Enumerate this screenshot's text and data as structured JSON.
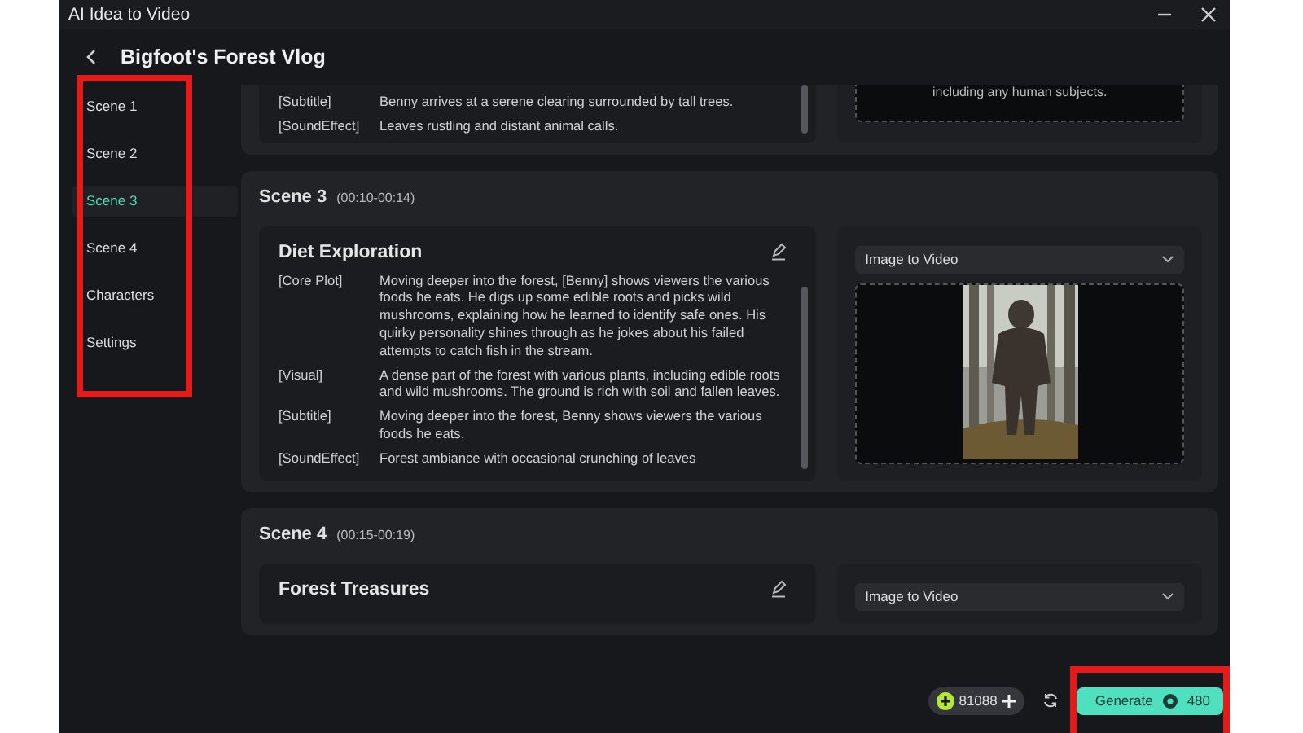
{
  "window": {
    "title": "AI Idea to Video"
  },
  "header": {
    "title": "Bigfoot's Forest Vlog"
  },
  "sidebar": {
    "items": [
      {
        "label": "Scene 1",
        "selected": false
      },
      {
        "label": "Scene 2",
        "selected": false
      },
      {
        "label": "Scene 3",
        "selected": true
      },
      {
        "label": "Scene 4",
        "selected": false
      },
      {
        "label": "Characters",
        "selected": false
      },
      {
        "label": "Settings",
        "selected": false
      }
    ]
  },
  "previous_scene": {
    "rows": [
      {
        "label": "[Subtitle]",
        "text": "Benny arrives at a serene clearing surrounded by tall trees."
      },
      {
        "label": "[SoundEffect]",
        "text": "Leaves rustling and distant animal calls."
      }
    ],
    "preview_text": "including any human subjects."
  },
  "scenes": [
    {
      "title": "Scene 3",
      "time": "(00:10-00:14)",
      "card": {
        "title": "Diet Exploration",
        "rows": [
          {
            "label": "[Core Plot]",
            "text": "Moving deeper into the forest, [Benny] shows viewers the various foods he eats. He digs up some edible roots and picks wild mushrooms, explaining how he learned to identify safe ones. His quirky personality shines through as he jokes about his failed attempts to catch fish in the stream."
          },
          {
            "label": "[Visual]",
            "text": "A dense part of the forest with various plants, including edible roots and wild mushrooms. The ground is rich with soil and fallen leaves."
          },
          {
            "label": "[Subtitle]",
            "text": "Moving deeper into the forest, Benny shows viewers the various foods he eats."
          },
          {
            "label": "[SoundEffect]",
            "text": "Forest ambiance with occasional crunching of leaves"
          }
        ]
      },
      "mode": "Image to Video"
    },
    {
      "title": "Scene 4",
      "time": "(00:15-00:19)",
      "card": {
        "title": "Forest Treasures"
      },
      "mode": "Image to Video"
    }
  ],
  "footer": {
    "credits": "81088",
    "generate": {
      "label": "Generate",
      "cost": "480"
    }
  }
}
